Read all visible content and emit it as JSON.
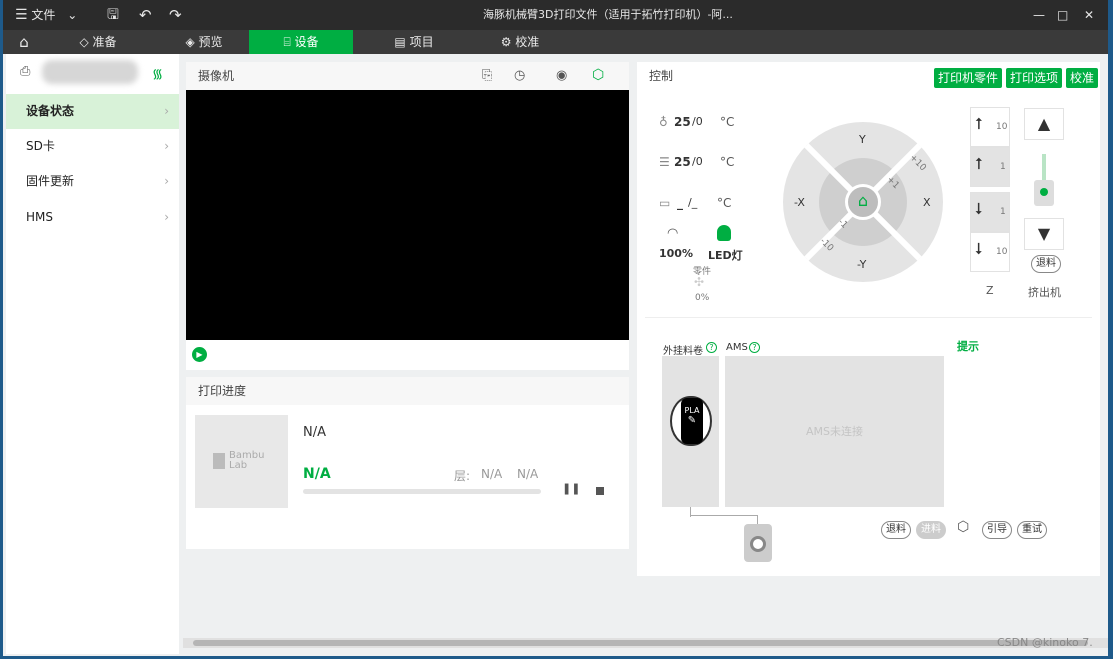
{
  "titlebar": {
    "menu_label": "文件",
    "title": "海豚机械臂3D打印文件（适用于拓竹打印机）-阿..."
  },
  "tabs": [
    {
      "label": "准备"
    },
    {
      "label": "预览"
    },
    {
      "label": "设备"
    },
    {
      "label": "项目"
    },
    {
      "label": "校准"
    }
  ],
  "sidebar": {
    "items": [
      {
        "label": "设备状态"
      },
      {
        "label": "SD卡"
      },
      {
        "label": "固件更新"
      },
      {
        "label": "HMS"
      }
    ]
  },
  "camera": {
    "title": "摄像机"
  },
  "progress": {
    "title": "打印进度",
    "logo_text_1": "Bambu",
    "logo_text_2": "Lab",
    "file_name": "N/A",
    "percent": "N/A",
    "layer_label": "层:",
    "layer_value": "N/A",
    "time_value": "N/A"
  },
  "control": {
    "title": "控制",
    "buttons": [
      "打印机零件",
      "打印选项",
      "校准"
    ],
    "nozzle_temp": "25",
    "nozzle_target": "/0",
    "bed_temp": "25",
    "bed_target": "/0",
    "chamber_temp": "_",
    "chamber_target": "/_",
    "unit": "°C",
    "speed": "100%",
    "led_label": "LED灯",
    "fan_label": "零件",
    "fan_value": "0%",
    "jog": {
      "y_plus": "Y",
      "y_minus": "-Y",
      "x_plus": "X",
      "x_minus": "-X",
      "p10": "+10",
      "p1": "+1",
      "m1": "-1",
      "m10": "-10"
    },
    "z_steps": [
      "10",
      "1",
      "1",
      "10"
    ],
    "z_label": "Z",
    "extruder_label": "挤出机",
    "retract_label": "退料"
  },
  "ams": {
    "external_label": "外挂料卷",
    "ams_label": "AMS",
    "hint_label": "提示",
    "spool_material": "PLA",
    "not_connected": "AMS未连接",
    "actions": [
      "退料",
      "进料",
      "引导",
      "重试"
    ]
  },
  "watermark": "CSDN @kinoko 7."
}
